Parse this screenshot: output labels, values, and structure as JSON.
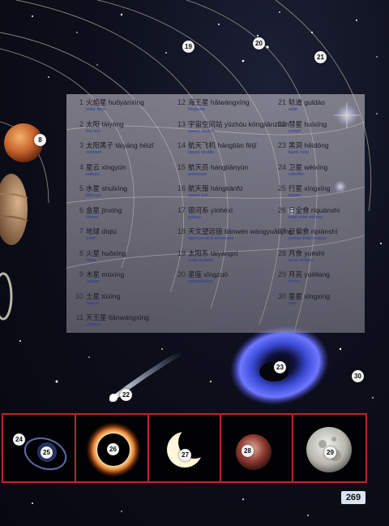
{
  "page_number": "269",
  "entries": [
    {
      "num": "1",
      "name": "火焰星 huǒyànxīng",
      "en": "solar flare"
    },
    {
      "num": "2",
      "name": "太阳 tàiyáng",
      "en": "the sun"
    },
    {
      "num": "3",
      "name": "太阳黑子 tàiyáng hēizǐ",
      "en": "sunspot"
    },
    {
      "num": "4",
      "name": "星云 xīngyún",
      "en": "nebula"
    },
    {
      "num": "5",
      "name": "水星 shuǐxīng",
      "en": "Mercury"
    },
    {
      "num": "6",
      "name": "金星 jīnxīng",
      "en": "Venus"
    },
    {
      "num": "7",
      "name": "地球 dìqiú",
      "en": "Earth"
    },
    {
      "num": "8",
      "name": "火星 huǒxīng",
      "en": "Mars"
    },
    {
      "num": "9",
      "name": "木星 mùxīng",
      "en": "Jupiter"
    },
    {
      "num": "10",
      "name": "土星 tǔxīng",
      "en": "Saturn"
    },
    {
      "num": "11",
      "name": "天王星 tiānwángxīng",
      "en": "Uranus"
    },
    {
      "num": "12",
      "name": "海王星 hǎiwángxīng",
      "en": "Neptune"
    },
    {
      "num": "13",
      "name": "宇宙空间站 yǔzhòu kōngjiānzhàn",
      "en": "space station"
    },
    {
      "num": "14",
      "name": "航天飞机 hángtiān fēijī",
      "en": "space shuttle"
    },
    {
      "num": "15",
      "name": "航天员 hángtiānyún",
      "en": "astronaut"
    },
    {
      "num": "16",
      "name": "航天服 hángtiānfú",
      "en": "space suit"
    },
    {
      "num": "17",
      "name": "银河系 yínhéxì",
      "en": "galaxy"
    },
    {
      "num": "18",
      "name": "天文望远镜 tiānwén wàngyuǎnjìng",
      "en": "astronomical telescope"
    },
    {
      "num": "19",
      "name": "太阳系 tàiyángxì",
      "en": "solar system"
    },
    {
      "num": "20",
      "name": "星座 xīngzuò",
      "en": "constellation"
    },
    {
      "num": "21",
      "name": "轨道 guǐdào",
      "en": "orbit"
    },
    {
      "num": "22",
      "name": "彗星 huìxīng",
      "en": "comet"
    },
    {
      "num": "23",
      "name": "黑洞 hēidòng",
      "en": "black hole"
    },
    {
      "num": "24",
      "name": "卫星 wèixīng",
      "en": "satellite"
    },
    {
      "num": "25",
      "name": "行星 xíngxīng",
      "en": "planet"
    },
    {
      "num": "26",
      "name": "日全食 rìquánshí",
      "en": "total solar eclipse"
    },
    {
      "num": "27",
      "name": "日偏食 rìpiānshí",
      "en": "partial solar eclipse"
    },
    {
      "num": "28",
      "name": "月食 yuèshí",
      "en": "lunar eclipse"
    },
    {
      "num": "29",
      "name": "月亮 yuèliang",
      "en": "moon"
    },
    {
      "num": "30",
      "name": "星星 xīngxing",
      "en": "star"
    }
  ],
  "badges": {
    "b8": "8",
    "b19": "19",
    "b20": "20",
    "b21": "21",
    "b22": "22",
    "b23": "23",
    "b24": "24",
    "b25": "25",
    "b26": "26",
    "b27": "27",
    "b28": "28",
    "b29": "29",
    "b30": "30"
  }
}
